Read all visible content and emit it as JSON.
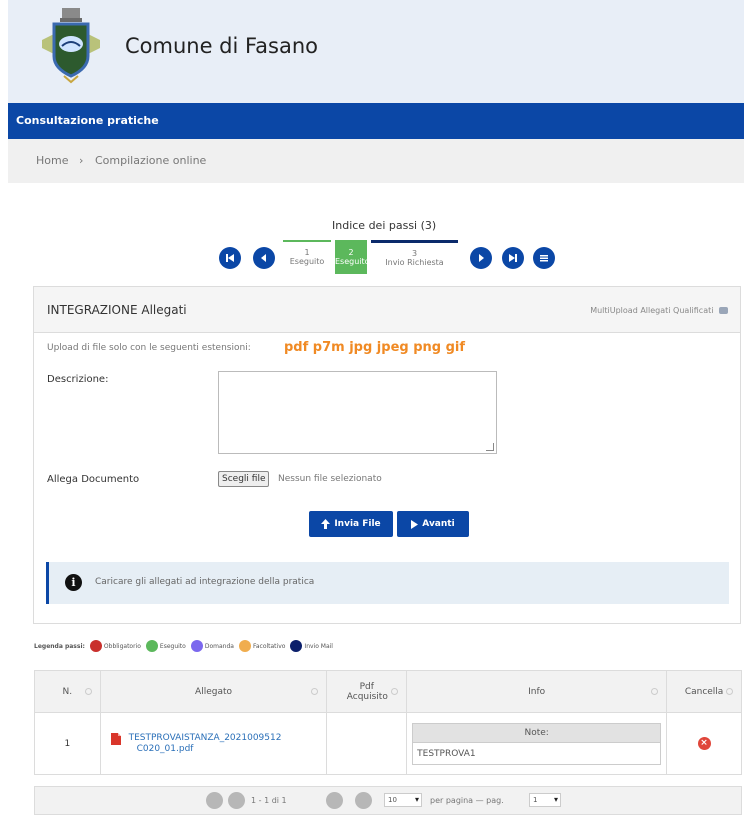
{
  "header": {
    "title": "Comune di Fasano"
  },
  "navbar": {
    "label": "Consultazione pratiche"
  },
  "breadcrumb": {
    "home": "Home",
    "separator": "›",
    "current": "Compilazione online"
  },
  "steps": {
    "title": "Indice dei passi (3)",
    "items": [
      {
        "number": "1",
        "label": "Eseguito"
      },
      {
        "number": "2",
        "label": "Eseguito"
      },
      {
        "number": "3",
        "label": "Invio Richiesta"
      }
    ]
  },
  "panel": {
    "title": "INTEGRAZIONE Allegati",
    "multiupload": "MultiUpload Allegati Qualificati",
    "upload_note": "Upload di file solo con le seguenti estensioni:",
    "extensions": "pdf p7m jpg jpeg png gif",
    "descrizione_label": "Descrizione:",
    "allega_label": "Allega Documento",
    "file_button": "Scegli file",
    "no_file": "Nessun file selezionato",
    "invia_label": "Invia File",
    "avanti_label": "Avanti",
    "info_text": "Caricare gli allegati ad integrazione della pratica"
  },
  "legend": {
    "title": "Legenda passi:",
    "items": [
      {
        "label": "Obbligatorio",
        "color": "#c9302c"
      },
      {
        "label": "Eseguito",
        "color": "#5cb85c"
      },
      {
        "label": "Domanda",
        "color": "#7b68ee"
      },
      {
        "label": "Facoltativo",
        "color": "#f0ad4e"
      },
      {
        "label": "Invio Mail",
        "color": "#0b1f6b"
      }
    ]
  },
  "table": {
    "headers": [
      "N.",
      "Allegato",
      "Pdf Acquisito",
      "Info",
      "Cancella"
    ],
    "rows": [
      {
        "n": "1",
        "allegato": "TESTPROVAISTANZA_20210095120020_01.pdf",
        "allegato_line1": "TESTPROVAISTANZA_2021009512",
        "allegato_line2": "C020_01.pdf",
        "pdf_acquisito": "",
        "note_label": "Note:",
        "note_value": "TESTPROVA1"
      }
    ]
  },
  "pager": {
    "range": "1 - 1 di 1",
    "page_size": "10",
    "per_page_label": "per pagina — pag.",
    "page": "1"
  },
  "colors": {
    "brand_blue": "#0b47a6",
    "step_done": "#5cb85c",
    "extensions_orange": "#f08a24"
  }
}
